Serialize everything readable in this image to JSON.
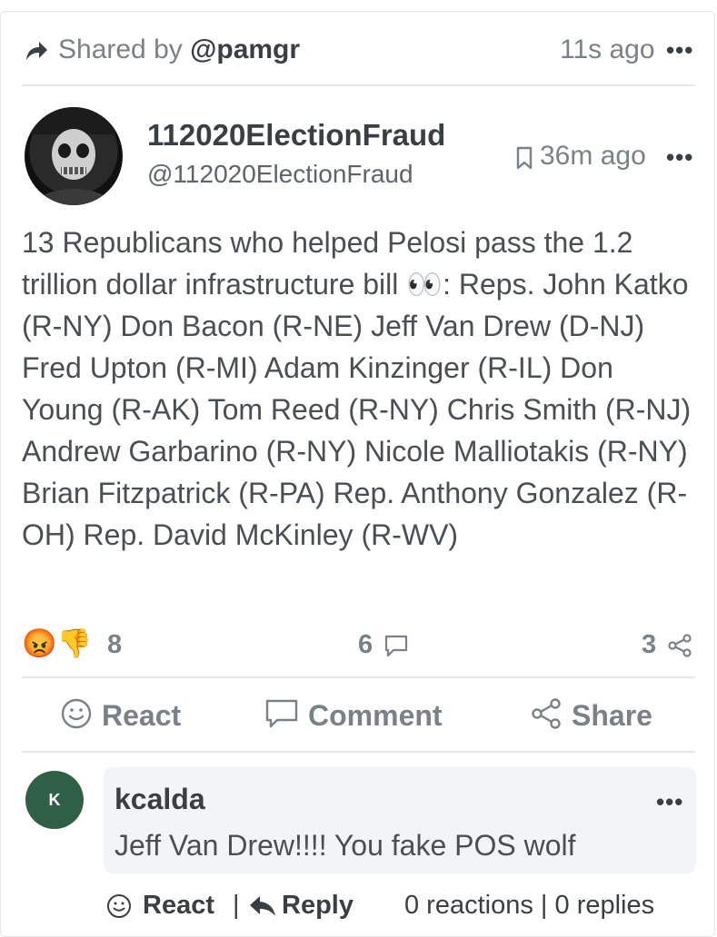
{
  "header": {
    "shared_prefix": "Shared by",
    "shared_user": "@pamgr",
    "time": "11s ago",
    "more": "•••"
  },
  "post": {
    "author_name": "112020ElectionFraud",
    "author_handle": "@112020ElectionFraud",
    "time": "36m ago",
    "more": "•••",
    "text": "13 Republicans who helped Pelosi pass the 1.2 trillion dollar infrastructure bill 👀:  Reps. John Katko (R-NY) Don Bacon (R-NE) Jeff Van Drew (D-NJ) Fred Upton (R-MI) Adam Kinzinger (R-IL) Don Young (R-AK) Tom Reed (R-NY) Chris Smith (R-NJ) Andrew Garbarino (R-NY) Nicole Malliotakis (R-NY) Brian Fitzpatrick (R-PA) Rep. Anthony Gonzalez (R-OH) Rep. David McKinley (R-WV)"
  },
  "stats": {
    "reaction_emojis": "😡👎",
    "reaction_count": "8",
    "comment_count": "6",
    "share_count": "3"
  },
  "actions": {
    "react": "React",
    "comment": "Comment",
    "share": "Share"
  },
  "comment": {
    "avatar_initial": "K",
    "author": "kcalda",
    "more": "•••",
    "text": "Jeff Van Drew!!!! You fake POS wolf",
    "react": "React",
    "separator": "|",
    "reply": "Reply",
    "summary": "0 reactions | 0 replies"
  },
  "icons": [
    "share-arrow-icon",
    "bookmark-icon",
    "comment-bubble-icon",
    "share-nodes-icon",
    "smiley-icon",
    "reply-arrow-icon"
  ]
}
